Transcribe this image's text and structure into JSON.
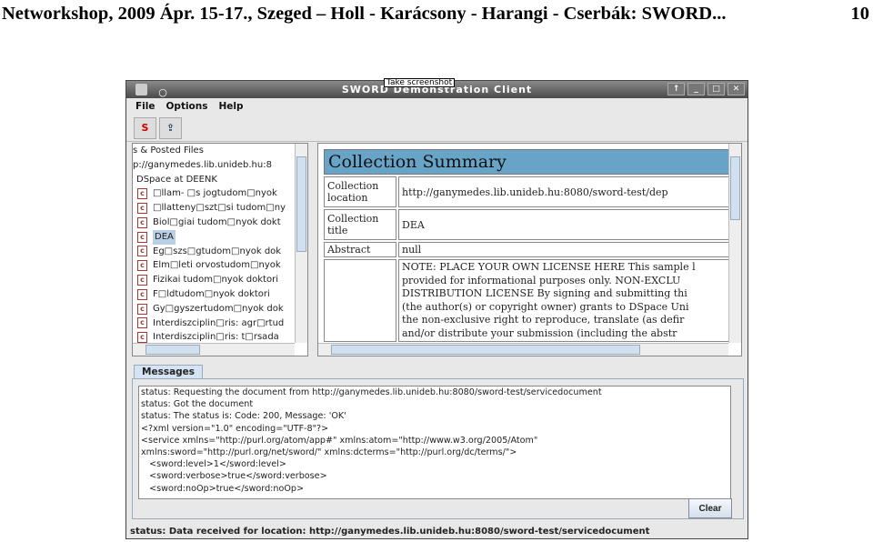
{
  "slide": {
    "header": "Networkshop, 2009 Ápr. 15-17., Szeged  –  Holl - Karácsony - Harangi - Cserbák: SWORD...",
    "page": "10"
  },
  "window": {
    "title": "SWORD Demonstration Client",
    "tooltip": "Take screenshot",
    "controls": [
      "↑",
      "_",
      "□",
      "✕"
    ]
  },
  "menu": [
    "File",
    "Options",
    "Help"
  ],
  "toolbar": [
    "S",
    "⇪"
  ],
  "tree": {
    "root": "s & Posted Files",
    "server": "p://ganymedes.lib.unideb.hu:8",
    "workspace": "DSpace at DEENK",
    "items": [
      "□llam- □s jogtudom□nyok",
      "□llatteny□szt□si tudom□ny",
      "Biol□giai tudom□nyok dokt",
      "DEA",
      "Eg□szs□gtudom□nyok dok",
      "Elm□leti orvostudom□nyok",
      "Fizikai tudom□nyok doktori",
      "F□ldtudom□nyok doktori",
      "Gy□gyszertudom□nyok dok",
      "Interdiszciplin□ris: agr□rtud",
      "Interdiszciplin□ris: t□rsada"
    ],
    "selected": "DEA"
  },
  "summary": {
    "title": "Collection Summary",
    "rows": [
      {
        "label": "Collection location",
        "value": "http://ganymedes.lib.unideb.hu:8080/sword-test/dep"
      },
      {
        "label": "Collection title",
        "value": "DEA"
      },
      {
        "label": "Abstract",
        "value": "null"
      }
    ],
    "license": [
      "NOTE: PLACE YOUR OWN LICENSE HERE This sample l",
      "provided for informational purposes only. NON-EXCLU",
      "DISTRIBUTION LICENSE By signing and submitting thi",
      "(the author(s) or copyright owner) grants to DSpace Uni",
      "the non-exclusive right to reproduce, translate (as defir",
      "and/or distribute your submission (including the abstr"
    ]
  },
  "messages": {
    "tab": "Messages",
    "lines": [
      "status: Requesting the document from http://ganymedes.lib.unideb.hu:8080/sword-test/servicedocument",
      "status: Got the document",
      "status: The status is: Code: 200, Message: 'OK'",
      "<?xml version=\"1.0\" encoding=\"UTF-8\"?>",
      "<service xmlns=\"http://purl.org/atom/app#\" xmlns:atom=\"http://www.w3.org/2005/Atom\"",
      "xmlns:sword=\"http://purl.org/net/sword/\" xmlns:dcterms=\"http://purl.org/dc/terms/\">",
      "   <sword:level>1</sword:level>",
      "   <sword:verbose>true</sword:verbose>",
      "   <sword:noOp>true</sword:noOp>"
    ],
    "clear": "Clear"
  },
  "status": "status: Data received for location: http://ganymedes.lib.unideb.hu:8080/sword-test/servicedocument"
}
